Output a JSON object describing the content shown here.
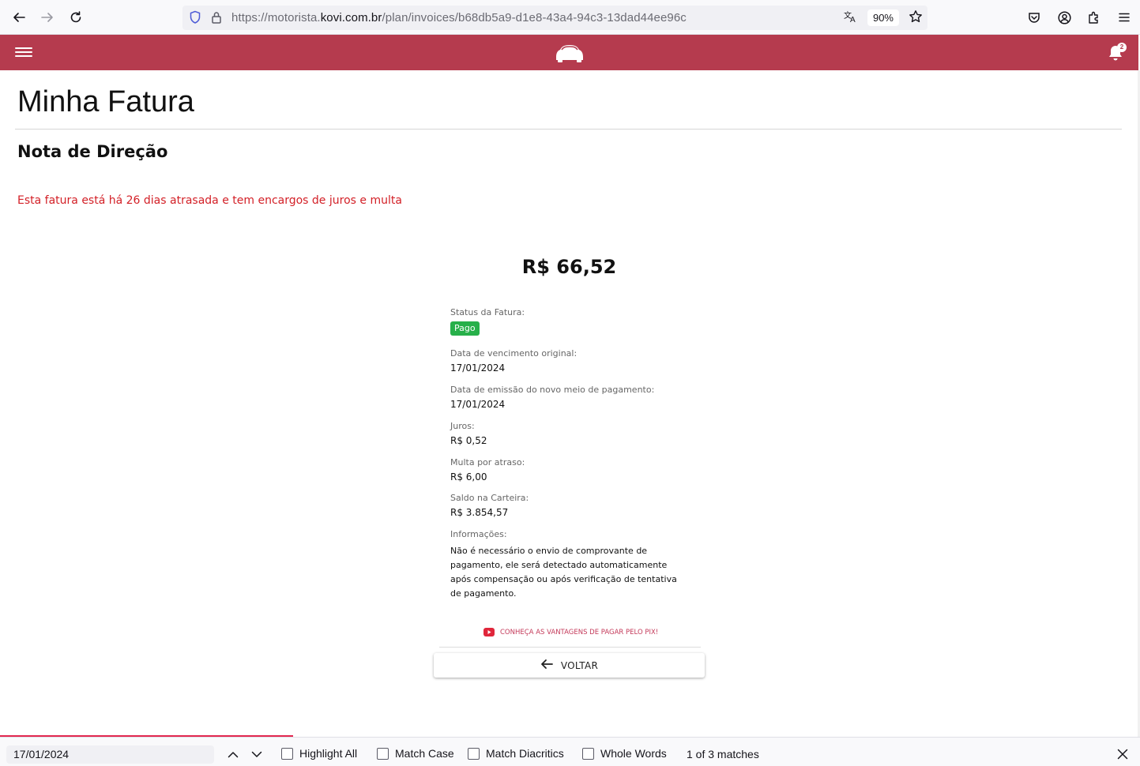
{
  "browser": {
    "url_prefix": "https://motorista.",
    "url_domain": "kovi.com.br",
    "url_path": "/plan/invoices/b68db5a9-d1e8-43a4-94c3-13dad44ee96c",
    "zoom": "90%"
  },
  "header": {
    "notification_count": "2",
    "accent_color": "#b53b4e"
  },
  "page": {
    "title": "Minha Fatura",
    "section_title": "Nota de Direção",
    "late_warning": "Esta fatura está há 26 dias atrasada e tem encargos de juros e multa",
    "amount": "R$ 66,52"
  },
  "details": {
    "status_label": "Status da Fatura:",
    "status_value": "Pago",
    "due_label": "Data de vencimento original:",
    "due_value": "17/01/2024",
    "issue_label": "Data de emissão do novo meio de pagamento:",
    "issue_value": "17/01/2024",
    "interest_label": "Juros:",
    "interest_value": "R$ 0,52",
    "fine_label": "Multa por atraso:",
    "fine_value": "R$ 6,00",
    "wallet_label": "Saldo na Carteira:",
    "wallet_value": "R$ 3.854,57",
    "info_label": "Informações:",
    "info_value": "Não é necessário o envio de comprovante de pagamento, ele será detectado automaticamente após compensação ou após verificação de tentativa de pagamento."
  },
  "actions": {
    "pix_link": "CONHEÇA AS VANTAGENS DE PAGAR PELO PIX!",
    "back_label": "VOLTAR"
  },
  "find_bar": {
    "query": "17/01/2024",
    "highlight_all": "Highlight All",
    "match_case": "Match Case",
    "match_diacritics": "Match Diacritics",
    "whole_words": "Whole Words",
    "status": "1 of 3 matches"
  }
}
